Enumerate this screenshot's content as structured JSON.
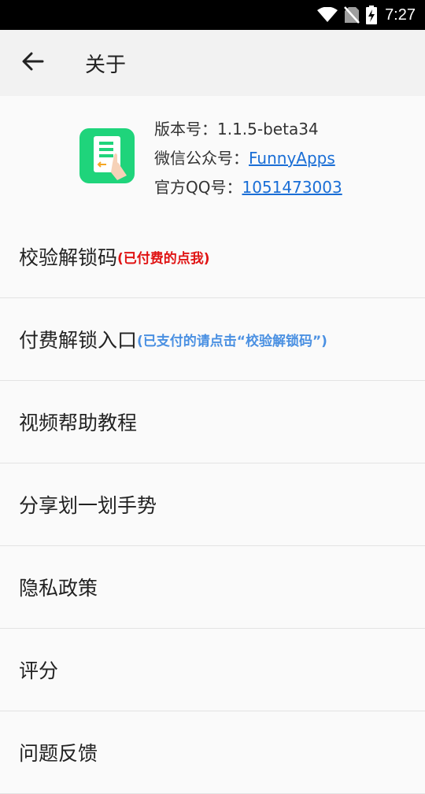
{
  "status_bar": {
    "time": "7:27",
    "icons": [
      "wifi-icon",
      "no-sim-icon",
      "battery-charging-icon"
    ]
  },
  "app_bar": {
    "back_icon": "arrow-left-icon",
    "title": "关于"
  },
  "about": {
    "logo_icon": "app-logo-icon",
    "logo_color": "#1fd47b",
    "version_label": "版本号：",
    "version_value": "1.1.5-beta34",
    "wechat_label": "微信公众号：",
    "wechat_value": "FunnyApps",
    "qq_label": "官方QQ号：",
    "qq_value": "1051473003"
  },
  "menu": {
    "items": [
      {
        "label": "校验解锁码",
        "note": "(已付费的点我)",
        "note_color": "#e01414"
      },
      {
        "label": "付费解锁入口",
        "note": "(已支付的请点击“校验解锁码”)",
        "note_color": "#4a90e2"
      },
      {
        "label": "视频帮助教程"
      },
      {
        "label": "分享划一划手势"
      },
      {
        "label": "隐私政策"
      },
      {
        "label": "评分"
      },
      {
        "label": "问题反馈"
      }
    ]
  }
}
